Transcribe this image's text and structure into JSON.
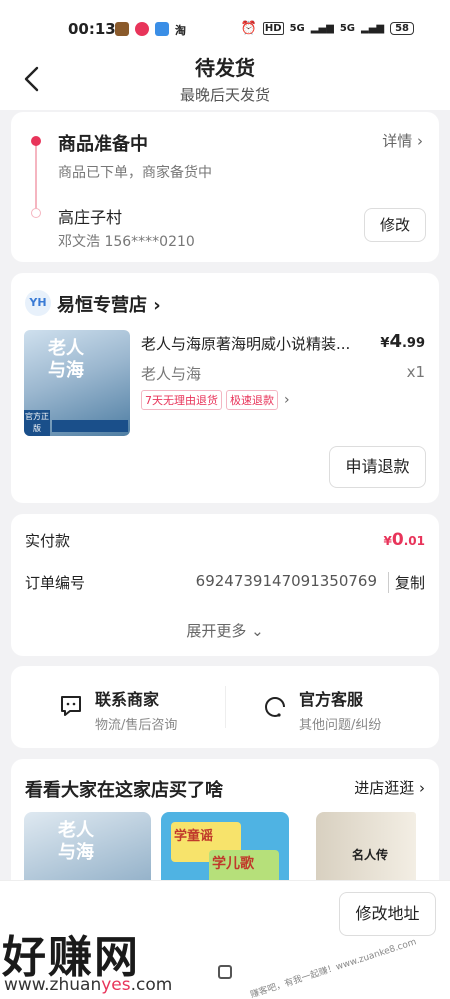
{
  "status_bar": {
    "time": "00:13",
    "app_icon_text": "淘",
    "hd": "HD",
    "signal1": "5G",
    "signal2": "5G",
    "battery": "58"
  },
  "header": {
    "title": "待发货",
    "subtitle": "最晚后天发货"
  },
  "order_status": {
    "title": "商品准备中",
    "desc": "商品已下单，商家备货中",
    "detail_label": "详情 ›",
    "address_name": "高庄子村",
    "person": "邓文浩  156****0210",
    "modify_label": "修改"
  },
  "shop": {
    "logo_text": "YH",
    "name": "易恒专营店 ›",
    "product": {
      "image_title_1": "老人",
      "image_title_2": "与海",
      "image_badge": "官方正版",
      "title": "老人与海原著海明威小说精装...",
      "price_symbol": "¥",
      "price_int": "4",
      "price_dec": ".99",
      "spec": "老人与海",
      "qty": "x1",
      "tags": [
        "7天无理由退货",
        "极速退款"
      ]
    },
    "refund_label": "申请退款"
  },
  "payment": {
    "paid_label": "实付款",
    "paid_symbol": "¥",
    "paid_int": "0",
    "paid_dec": ".01",
    "order_label": "订单编号",
    "order_number": "6924739147091350769",
    "copy_label": "复制",
    "expand_label": "展开更多 ⌄"
  },
  "service": {
    "contact_title": "联系商家",
    "contact_sub": "物流/售后咨询",
    "support_title": "官方客服",
    "support_sub": "其他问题/纠纷"
  },
  "recommend": {
    "title": "看看大家在这家店买了啥",
    "shop_link": "进店逛逛 ›",
    "item1_title": "老人\n与海",
    "item2_title_1": "学童谣",
    "item2_title_2": "学儿歌",
    "item3_title": "名人传"
  },
  "bottom": {
    "address_button": "修改地址",
    "watermark": "好赚网",
    "url_prefix": "www.zhuan",
    "url_highlight": "yes",
    "url_suffix": ".com",
    "stamp": "赚客吧，有我一起赚！www.zuanke8.com"
  },
  "colors": {
    "accent": "#e8345a",
    "tag_border": "#f3b6c3"
  }
}
